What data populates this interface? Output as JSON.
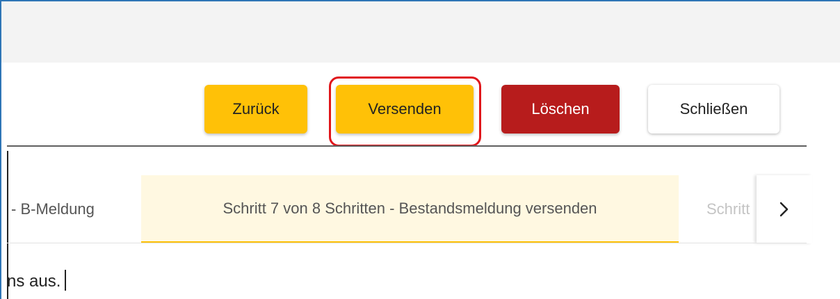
{
  "toolbar": {
    "back_label": "Zurück",
    "send_label": "Versenden",
    "delete_label": "Löschen",
    "close_label": "Schließen"
  },
  "colors": {
    "primary_yellow": "#ffc107",
    "danger_red": "#b71c1c",
    "highlight_red": "#e0161b",
    "active_tab_bg": "#fff8e1"
  },
  "tabs": {
    "previous_label": "- B-Meldung",
    "active_label": "Schritt 7 von 8 Schritten - Bestandsmeldung versenden",
    "next_label": "Schritt",
    "scroll_icon": "chevron-right-icon"
  },
  "content": {
    "text": "ns aus."
  }
}
